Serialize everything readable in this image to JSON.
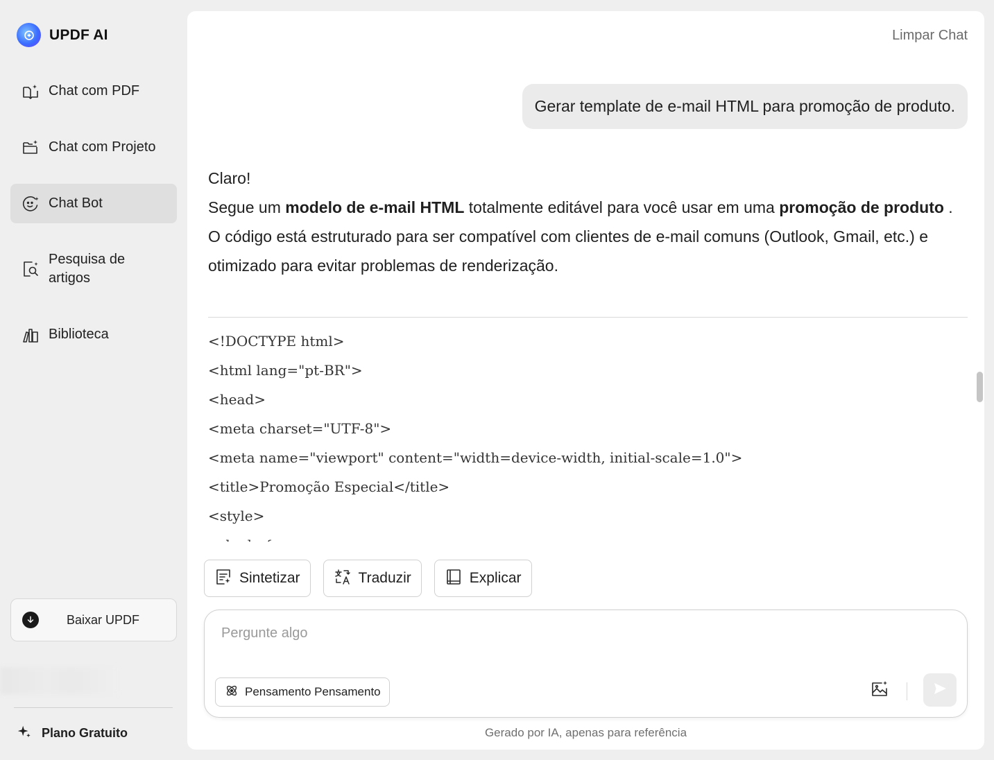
{
  "brand": {
    "name": "UPDF AI"
  },
  "sidebar": {
    "items": [
      {
        "label": "Chat com PDF",
        "icon": "book-sparkle-icon"
      },
      {
        "label": "Chat com Projeto",
        "icon": "folder-sparkle-icon"
      },
      {
        "label": "Chat Bot",
        "icon": "bot-face-icon",
        "active": true
      },
      {
        "label": "Pesquisa de artigos",
        "icon": "document-search-icon"
      },
      {
        "label": "Biblioteca",
        "icon": "library-icon"
      }
    ],
    "download_label": "Baixar UPDF",
    "plan_label": "Plano Gratuito"
  },
  "header": {
    "clear_chat": "Limpar Chat"
  },
  "chat": {
    "user_message": "Gerar template de e-mail HTML para promoção de produto.",
    "answer": {
      "line1": "Claro!",
      "p2_a": "Segue um ",
      "p2_b": "modelo de e-mail HTML",
      "p2_c": " totalmente editável para você usar em uma ",
      "p2_d": "promoção de produto",
      "p2_e": " .",
      "p3": "O código está estruturado para ser compatível com clientes de e-mail comuns (Outlook, Gmail, etc.) e otimizado para evitar problemas de renderização."
    },
    "code_lines": [
      "<!DOCTYPE html>",
      "<html lang=\"pt-BR\">",
      "<head>",
      "<meta charset=\"UTF-8\">",
      "<meta name=\"viewport\" content=\"width=device-width, initial-scale=1.0\">",
      "<title>Promoção Especial</title>",
      "<style>",
      "    body {"
    ]
  },
  "actions": {
    "summarize": "Sintetizar",
    "translate": "Traduzir",
    "explain": "Explicar"
  },
  "input": {
    "placeholder": "Pergunte algo",
    "thinking_label": "Pensamento Pensamento"
  },
  "footer": {
    "note": "Gerado por IA, apenas para referência"
  },
  "colors": {
    "accent": "#3b6dff",
    "active_nav": "#dfdfdf",
    "panel": "#ffffff",
    "background": "#efefef"
  }
}
